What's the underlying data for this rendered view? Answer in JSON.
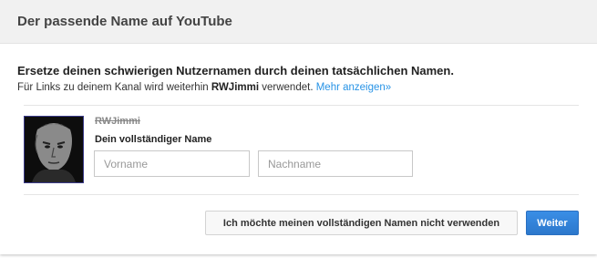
{
  "dialog": {
    "title": "Der passende Name auf YouTube",
    "headline": "Ersetze deinen schwierigen Nutzernamen durch deinen tatsächlichen Namen.",
    "sub_prefix": "Für Links zu deinem Kanal wird weiterhin ",
    "username": "RWJimmi",
    "sub_suffix": " verwendet. ",
    "more_link": "Mehr anzeigen»",
    "old_name": "RWJimmi",
    "full_name_label": "Dein vollständiger Name",
    "first_name_placeholder": "Vorname",
    "last_name_placeholder": "Nachname",
    "first_name_value": "",
    "last_name_value": "",
    "decline_button": "Ich möchte meinen vollständigen Namen nicht verwenden",
    "continue_button": "Weiter"
  },
  "colors": {
    "primary_button": "#2f7ed8",
    "link": "#2793e6",
    "header_bg": "#f1f1f1"
  }
}
